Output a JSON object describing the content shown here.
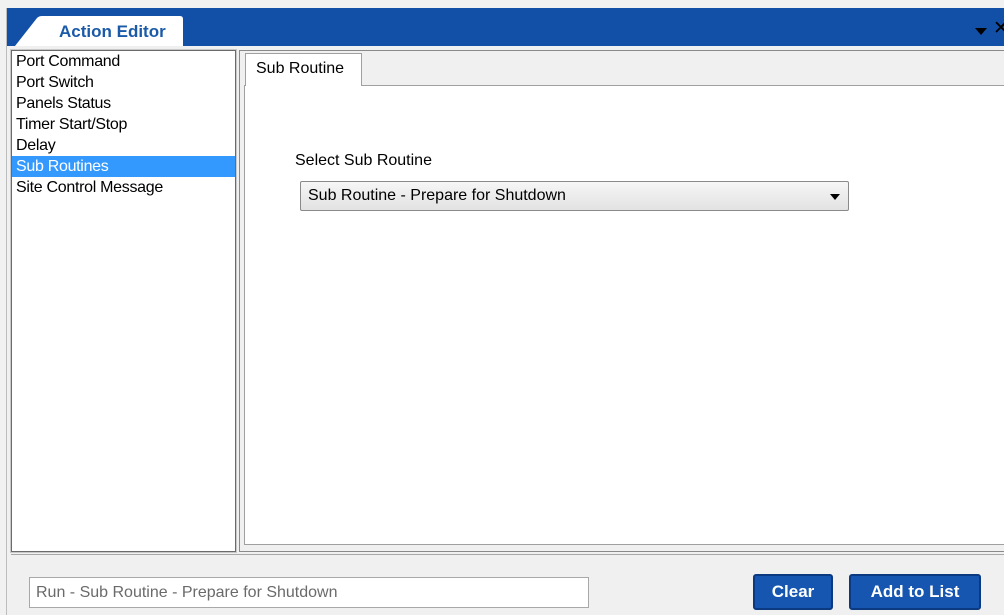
{
  "window": {
    "tab_title": "Action Editor"
  },
  "action_list": {
    "items": [
      {
        "label": "Port Command",
        "selected": false
      },
      {
        "label": "Port Switch",
        "selected": false
      },
      {
        "label": "Panels Status",
        "selected": false
      },
      {
        "label": "Timer Start/Stop",
        "selected": false
      },
      {
        "label": "Delay",
        "selected": false
      },
      {
        "label": "Sub Routines",
        "selected": true
      },
      {
        "label": "Site Control Message",
        "selected": false
      }
    ]
  },
  "content": {
    "tab_label": "Sub Routine",
    "field_label": "Select Sub Routine",
    "selected_value": "Sub Routine - Prepare for Shutdown"
  },
  "footer": {
    "summary_value": "Run - Sub Routine - Prepare for Shutdown",
    "clear_label": "Clear",
    "add_label": "Add to List"
  },
  "colors": {
    "header_blue": "#1250a8",
    "selection_blue": "#3399ff",
    "button_blue": "#1656b0"
  },
  "icons": {
    "menu_dropdown": "chevron-down-icon",
    "close": "close-icon",
    "select_arrow": "dropdown-arrow-icon"
  }
}
